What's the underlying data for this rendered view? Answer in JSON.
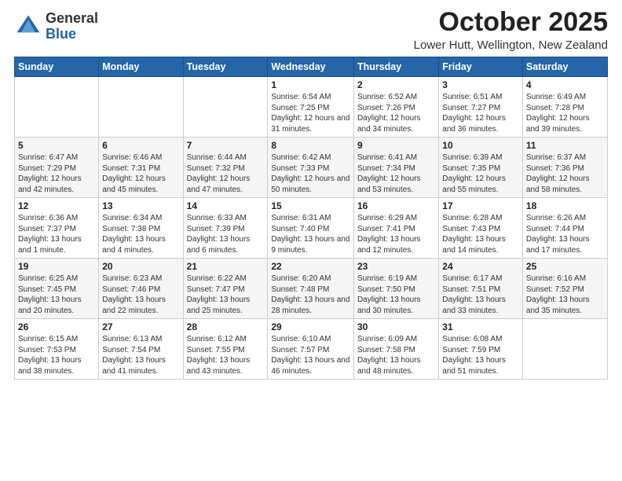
{
  "logo": {
    "general": "General",
    "blue": "Blue"
  },
  "title": "October 2025",
  "subtitle": "Lower Hutt, Wellington, New Zealand",
  "headers": [
    "Sunday",
    "Monday",
    "Tuesday",
    "Wednesday",
    "Thursday",
    "Friday",
    "Saturday"
  ],
  "weeks": [
    [
      {
        "day": "",
        "info": ""
      },
      {
        "day": "",
        "info": ""
      },
      {
        "day": "",
        "info": ""
      },
      {
        "day": "1",
        "info": "Sunrise: 6:54 AM\nSunset: 7:25 PM\nDaylight: 12 hours and 31 minutes."
      },
      {
        "day": "2",
        "info": "Sunrise: 6:52 AM\nSunset: 7:26 PM\nDaylight: 12 hours and 34 minutes."
      },
      {
        "day": "3",
        "info": "Sunrise: 6:51 AM\nSunset: 7:27 PM\nDaylight: 12 hours and 36 minutes."
      },
      {
        "day": "4",
        "info": "Sunrise: 6:49 AM\nSunset: 7:28 PM\nDaylight: 12 hours and 39 minutes."
      }
    ],
    [
      {
        "day": "5",
        "info": "Sunrise: 6:47 AM\nSunset: 7:29 PM\nDaylight: 12 hours and 42 minutes."
      },
      {
        "day": "6",
        "info": "Sunrise: 6:46 AM\nSunset: 7:31 PM\nDaylight: 12 hours and 45 minutes."
      },
      {
        "day": "7",
        "info": "Sunrise: 6:44 AM\nSunset: 7:32 PM\nDaylight: 12 hours and 47 minutes."
      },
      {
        "day": "8",
        "info": "Sunrise: 6:42 AM\nSunset: 7:33 PM\nDaylight: 12 hours and 50 minutes."
      },
      {
        "day": "9",
        "info": "Sunrise: 6:41 AM\nSunset: 7:34 PM\nDaylight: 12 hours and 53 minutes."
      },
      {
        "day": "10",
        "info": "Sunrise: 6:39 AM\nSunset: 7:35 PM\nDaylight: 12 hours and 55 minutes."
      },
      {
        "day": "11",
        "info": "Sunrise: 6:37 AM\nSunset: 7:36 PM\nDaylight: 12 hours and 58 minutes."
      }
    ],
    [
      {
        "day": "12",
        "info": "Sunrise: 6:36 AM\nSunset: 7:37 PM\nDaylight: 13 hours and 1 minute."
      },
      {
        "day": "13",
        "info": "Sunrise: 6:34 AM\nSunset: 7:38 PM\nDaylight: 13 hours and 4 minutes."
      },
      {
        "day": "14",
        "info": "Sunrise: 6:33 AM\nSunset: 7:39 PM\nDaylight: 13 hours and 6 minutes."
      },
      {
        "day": "15",
        "info": "Sunrise: 6:31 AM\nSunset: 7:40 PM\nDaylight: 13 hours and 9 minutes."
      },
      {
        "day": "16",
        "info": "Sunrise: 6:29 AM\nSunset: 7:41 PM\nDaylight: 13 hours and 12 minutes."
      },
      {
        "day": "17",
        "info": "Sunrise: 6:28 AM\nSunset: 7:43 PM\nDaylight: 13 hours and 14 minutes."
      },
      {
        "day": "18",
        "info": "Sunrise: 6:26 AM\nSunset: 7:44 PM\nDaylight: 13 hours and 17 minutes."
      }
    ],
    [
      {
        "day": "19",
        "info": "Sunrise: 6:25 AM\nSunset: 7:45 PM\nDaylight: 13 hours and 20 minutes."
      },
      {
        "day": "20",
        "info": "Sunrise: 6:23 AM\nSunset: 7:46 PM\nDaylight: 13 hours and 22 minutes."
      },
      {
        "day": "21",
        "info": "Sunrise: 6:22 AM\nSunset: 7:47 PM\nDaylight: 13 hours and 25 minutes."
      },
      {
        "day": "22",
        "info": "Sunrise: 6:20 AM\nSunset: 7:48 PM\nDaylight: 13 hours and 28 minutes."
      },
      {
        "day": "23",
        "info": "Sunrise: 6:19 AM\nSunset: 7:50 PM\nDaylight: 13 hours and 30 minutes."
      },
      {
        "day": "24",
        "info": "Sunrise: 6:17 AM\nSunset: 7:51 PM\nDaylight: 13 hours and 33 minutes."
      },
      {
        "day": "25",
        "info": "Sunrise: 6:16 AM\nSunset: 7:52 PM\nDaylight: 13 hours and 35 minutes."
      }
    ],
    [
      {
        "day": "26",
        "info": "Sunrise: 6:15 AM\nSunset: 7:53 PM\nDaylight: 13 hours and 38 minutes."
      },
      {
        "day": "27",
        "info": "Sunrise: 6:13 AM\nSunset: 7:54 PM\nDaylight: 13 hours and 41 minutes."
      },
      {
        "day": "28",
        "info": "Sunrise: 6:12 AM\nSunset: 7:55 PM\nDaylight: 13 hours and 43 minutes."
      },
      {
        "day": "29",
        "info": "Sunrise: 6:10 AM\nSunset: 7:57 PM\nDaylight: 13 hours and 46 minutes."
      },
      {
        "day": "30",
        "info": "Sunrise: 6:09 AM\nSunset: 7:58 PM\nDaylight: 13 hours and 48 minutes."
      },
      {
        "day": "31",
        "info": "Sunrise: 6:08 AM\nSunset: 7:59 PM\nDaylight: 13 hours and 51 minutes."
      },
      {
        "day": "",
        "info": ""
      }
    ]
  ]
}
